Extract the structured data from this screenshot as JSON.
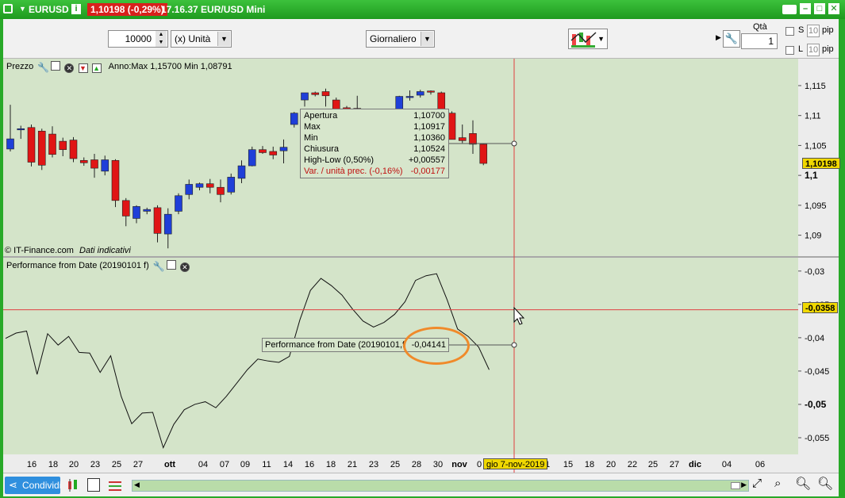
{
  "title": {
    "symbol": "EURUSD",
    "price_change": "1,10198 (-0,29%)",
    "time_info": "17.16.37 EUR/USD Mini"
  },
  "toolbar": {
    "quantity_value": "10000",
    "unit_select": "(x) Unità",
    "period_select": "Giornaliero",
    "qty_label": "Qtà",
    "qty_value": "1",
    "s_label": "S",
    "l_label": "L",
    "pip_value_s": "10",
    "pip_value_l": "10",
    "pip_unit": "pip"
  },
  "price_panel": {
    "name": "Prezzo",
    "year_info": "Anno:Max 1,15700 Min 1,08791",
    "copyright": "© IT-Finance.com",
    "data_note": "Dati indicativi",
    "y_ticks": [
      "1,115",
      "1,11",
      "1,105",
      "1,1",
      "1,095",
      "1,09"
    ],
    "last_price_tag": "1,10198"
  },
  "tooltip": {
    "rows": [
      {
        "label": "Apertura",
        "value": "1,10700"
      },
      {
        "label": "Max",
        "value": "1,10917"
      },
      {
        "label": "Min",
        "value": "1,10360"
      },
      {
        "label": "Chiusura",
        "value": "1,10524"
      },
      {
        "label": "High-Low (0,50%)",
        "value": "+0,00557"
      },
      {
        "label": "Var. / unità prec. (-0,16%)",
        "value": "-0,00177"
      }
    ]
  },
  "perf_panel": {
    "name": "Performance from Date (20190101 f)",
    "y_ticks": [
      "-0,03",
      "-0,035",
      "-0,04",
      "-0,045",
      "-0,05",
      "-0,055"
    ],
    "cursor_tag": "-0,0358",
    "value_label": "Performance from Date (20190101,f",
    "value": "-0,04141"
  },
  "x_axis": {
    "labels": [
      "16",
      "18",
      "20",
      "23",
      "25",
      "27",
      "ott",
      "04",
      "07",
      "09",
      "11",
      "14",
      "16",
      "18",
      "21",
      "23",
      "25",
      "28",
      "30",
      "nov",
      "0",
      "",
      "1",
      "15",
      "18",
      "20",
      "22",
      "25",
      "27",
      "dic",
      "04",
      "06"
    ],
    "cursor_date": "gio 7-nov-2019"
  },
  "bottom": {
    "share_label": "Condividi"
  },
  "colors": {
    "up": "#1f3fd8",
    "down": "#e01515",
    "panel_bg": "#d4e4c9",
    "cursor": "#e04040",
    "highlight": "#f08a2a"
  },
  "chart_data": {
    "type": "candlestick",
    "series": [
      {
        "name": "EURUSD",
        "ohlc": [
          [
            1.1044,
            1.1118,
            1.104,
            1.1061
          ],
          [
            1.1078,
            1.1083,
            1.1061,
            1.1078
          ],
          [
            1.108,
            1.1085,
            1.1015,
            1.1022
          ],
          [
            1.1074,
            1.1078,
            1.1009,
            1.1017
          ],
          [
            1.1069,
            1.1082,
            1.103,
            1.1035
          ],
          [
            1.1057,
            1.1063,
            1.1032,
            1.1043
          ],
          [
            1.1059,
            1.1064,
            1.1022,
            1.1028
          ],
          [
            1.1025,
            1.103,
            1.1016,
            1.1021
          ],
          [
            1.1026,
            1.1036,
            1.0996,
            1.1012
          ],
          [
            1.1007,
            1.1033,
            1.1,
            1.1026
          ],
          [
            1.1025,
            1.1027,
            1.0947,
            1.0958
          ],
          [
            1.0958,
            1.0962,
            1.0915,
            1.0932
          ],
          [
            1.0928,
            1.095,
            1.092,
            1.0948
          ],
          [
            1.094,
            1.0946,
            1.0935,
            1.0943
          ],
          [
            1.0946,
            1.095,
            1.0888,
            1.0903
          ],
          [
            1.0902,
            1.0945,
            1.0878,
            1.0935
          ],
          [
            1.094,
            1.097,
            1.0935,
            1.0966
          ],
          [
            1.0968,
            1.0993,
            1.096,
            1.0985
          ],
          [
            1.098,
            1.0988,
            1.0975,
            1.0986
          ],
          [
            1.0986,
            1.0994,
            1.097,
            1.098
          ],
          [
            1.098,
            1.0993,
            1.0955,
            1.0968
          ],
          [
            1.0972,
            1.1003,
            1.0968,
            1.0997
          ],
          [
            1.0995,
            1.1025,
            1.0987,
            1.1016
          ],
          [
            1.1016,
            1.1048,
            1.1015,
            1.1043
          ],
          [
            1.1043,
            1.1049,
            1.1036,
            1.1038
          ],
          [
            1.104,
            1.1048,
            1.1027,
            1.1034
          ],
          [
            1.1041,
            1.106,
            1.102,
            1.1047
          ],
          [
            1.1085,
            1.1106,
            1.108,
            1.1104
          ],
          [
            1.1126,
            1.1138,
            1.1115,
            1.1138
          ],
          [
            1.1138,
            1.114,
            1.1132,
            1.1135
          ],
          [
            1.114,
            1.1145,
            1.1115,
            1.1133
          ],
          [
            1.1126,
            1.113,
            1.1102,
            1.1111
          ],
          [
            1.1113,
            1.1116,
            1.1108,
            1.1112
          ],
          [
            1.1112,
            1.1133,
            1.1086,
            1.1087
          ],
          [
            1.1095,
            1.1098,
            1.1066,
            1.1074
          ],
          [
            1.1072,
            1.1078,
            1.1066,
            1.107
          ],
          [
            1.107,
            1.1084,
            1.1066,
            1.1081
          ],
          [
            1.1095,
            1.1133,
            1.1093,
            1.1132
          ],
          [
            1.113,
            1.1142,
            1.1125,
            1.1132
          ],
          [
            1.1134,
            1.1143,
            1.113,
            1.114
          ],
          [
            1.1141,
            1.1142,
            1.1135,
            1.1139
          ],
          [
            1.1138,
            1.114,
            1.1106,
            1.1106
          ],
          [
            1.1104,
            1.1107,
            1.106,
            1.106
          ],
          [
            1.1063,
            1.1085,
            1.1054,
            1.1058
          ],
          [
            1.107,
            1.1092,
            1.1036,
            1.1052
          ],
          [
            1.1052,
            1.1053,
            1.1017,
            1.102
          ]
        ]
      },
      {
        "name": "Performance from Date (20190101 f)",
        "values": [
          -0.0401,
          -0.0393,
          -0.039,
          -0.0455,
          -0.0394,
          -0.0411,
          -0.0398,
          -0.0422,
          -0.0423,
          -0.0452,
          -0.0427,
          -0.0488,
          -0.0529,
          -0.0513,
          -0.0512,
          -0.0565,
          -0.053,
          -0.0508,
          -0.05,
          -0.0496,
          -0.0505,
          -0.0488,
          -0.0468,
          -0.0448,
          -0.0432,
          -0.0435,
          -0.0437,
          -0.0428,
          -0.0373,
          -0.0329,
          -0.0311,
          -0.0322,
          -0.0336,
          -0.0357,
          -0.0375,
          -0.0384,
          -0.0377,
          -0.0365,
          -0.0346,
          -0.0314,
          -0.0307,
          -0.0304,
          -0.0343,
          -0.0387,
          -0.0398,
          -0.0414,
          -0.0448
        ]
      }
    ],
    "y_range_price": [
      1.0865,
      1.1195
    ],
    "y_range_perf": [
      -0.0575,
      -0.028
    ]
  }
}
